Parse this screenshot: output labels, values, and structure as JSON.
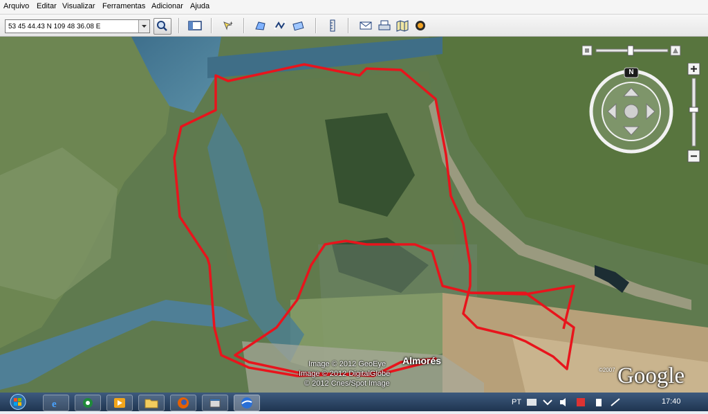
{
  "menu": [
    "Arquivo",
    "Editar",
    "Visualizar",
    "Ferramentas",
    "Adicionar",
    "Ajuda"
  ],
  "search": {
    "value": "53 45 44.43 N 109 48 36.08 E"
  },
  "map": {
    "credits": [
      "Image © 2012 GeoEye",
      "Image © 2012 DigitalGlobe",
      "© 2012 Cnes/Spot Image"
    ],
    "place_label": "Almorés",
    "logo_text": "Google",
    "logo_year": "©2007",
    "outline_color": "#e8141c",
    "compass_letter": "N"
  },
  "taskbar": {
    "language": "PT",
    "clock": "17:40"
  }
}
